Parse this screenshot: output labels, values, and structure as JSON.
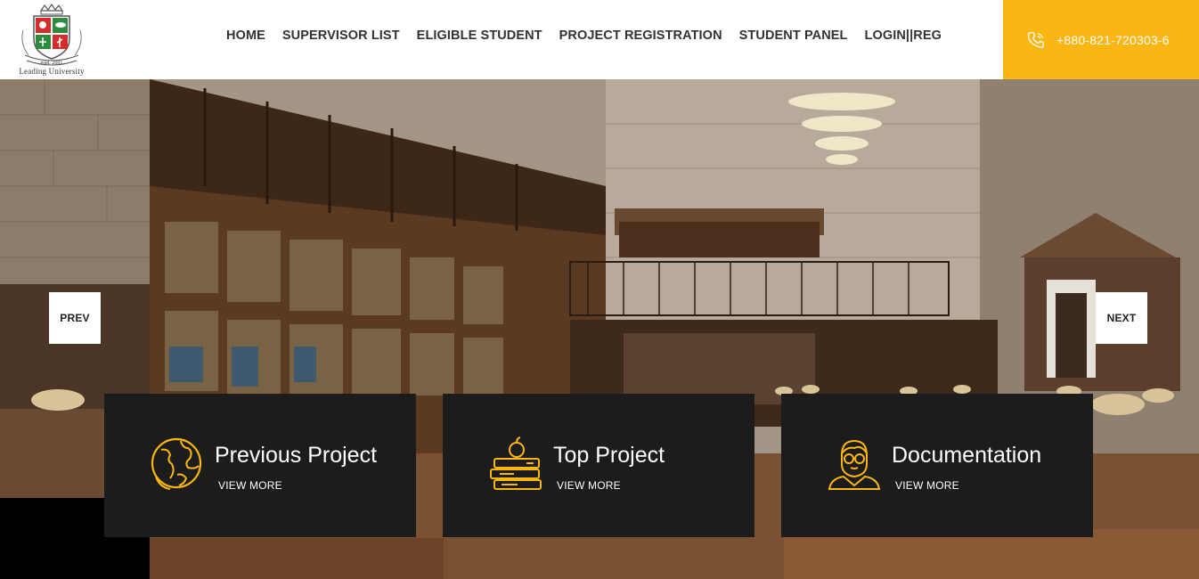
{
  "logo": {
    "text": "Leading University",
    "estd": "estd. 2001"
  },
  "nav": {
    "items": [
      {
        "label": "HOME"
      },
      {
        "label": "SUPERVISOR LIST"
      },
      {
        "label": "ELIGIBLE STUDENT"
      },
      {
        "label": "PROJECT REGISTRATION"
      },
      {
        "label": "STUDENT PANEL"
      },
      {
        "label": "LOGIN||REG"
      }
    ]
  },
  "contact": {
    "phone": "+880-821-720303-6",
    "icon": "phone-icon"
  },
  "slider": {
    "prev_label": "PREV",
    "next_label": "NEXT"
  },
  "cards": [
    {
      "title": "Previous Project",
      "link": "VIEW MORE",
      "icon": "globe-icon"
    },
    {
      "title": "Top Project",
      "link": "VIEW MORE",
      "icon": "books-apple-icon"
    },
    {
      "title": "Documentation",
      "link": "VIEW MORE",
      "icon": "student-glasses-icon"
    }
  ],
  "colors": {
    "accent": "#fbb613",
    "card_bg": "#1c1c1c",
    "nav_text": "#333333"
  }
}
